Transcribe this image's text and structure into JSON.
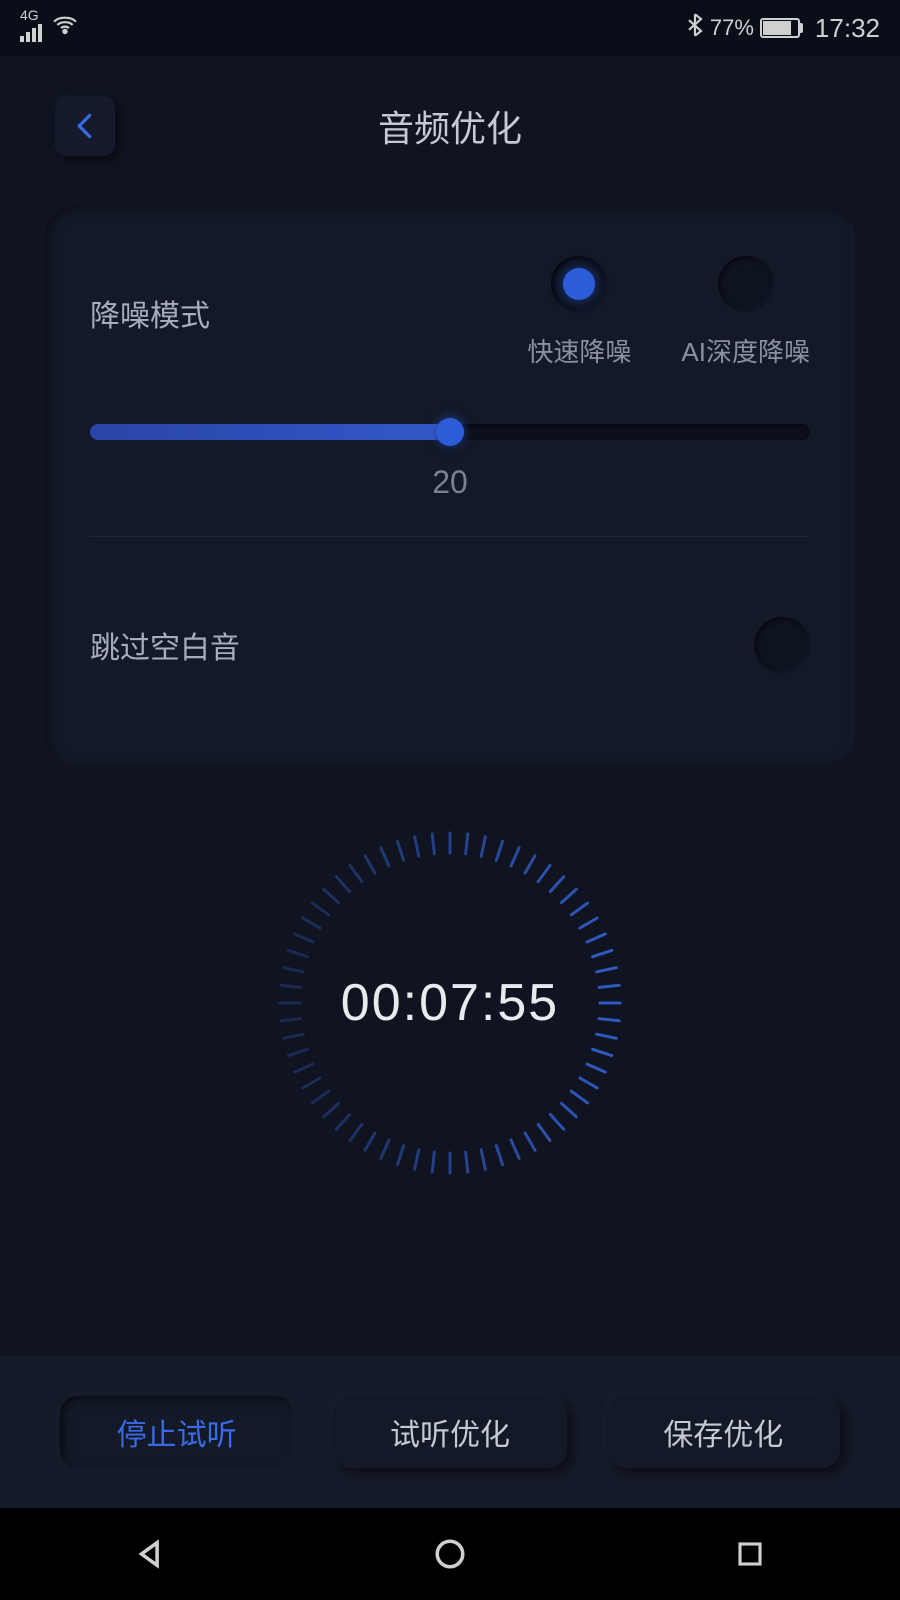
{
  "status": {
    "network": "4G",
    "bluetooth_icon": "bluetooth",
    "battery_percent": "77%",
    "time": "17:32"
  },
  "header": {
    "title": "音频优化"
  },
  "noise": {
    "label": "降噪模式",
    "options": {
      "fast": "快速降噪",
      "ai": "AI深度降噪"
    }
  },
  "slider": {
    "value": "20",
    "percent": 50
  },
  "skip": {
    "label": "跳过空白音"
  },
  "timer": {
    "value": "00:07:55"
  },
  "buttons": {
    "stop": "停止试听",
    "preview": "试听优化",
    "save": "保存优化"
  }
}
